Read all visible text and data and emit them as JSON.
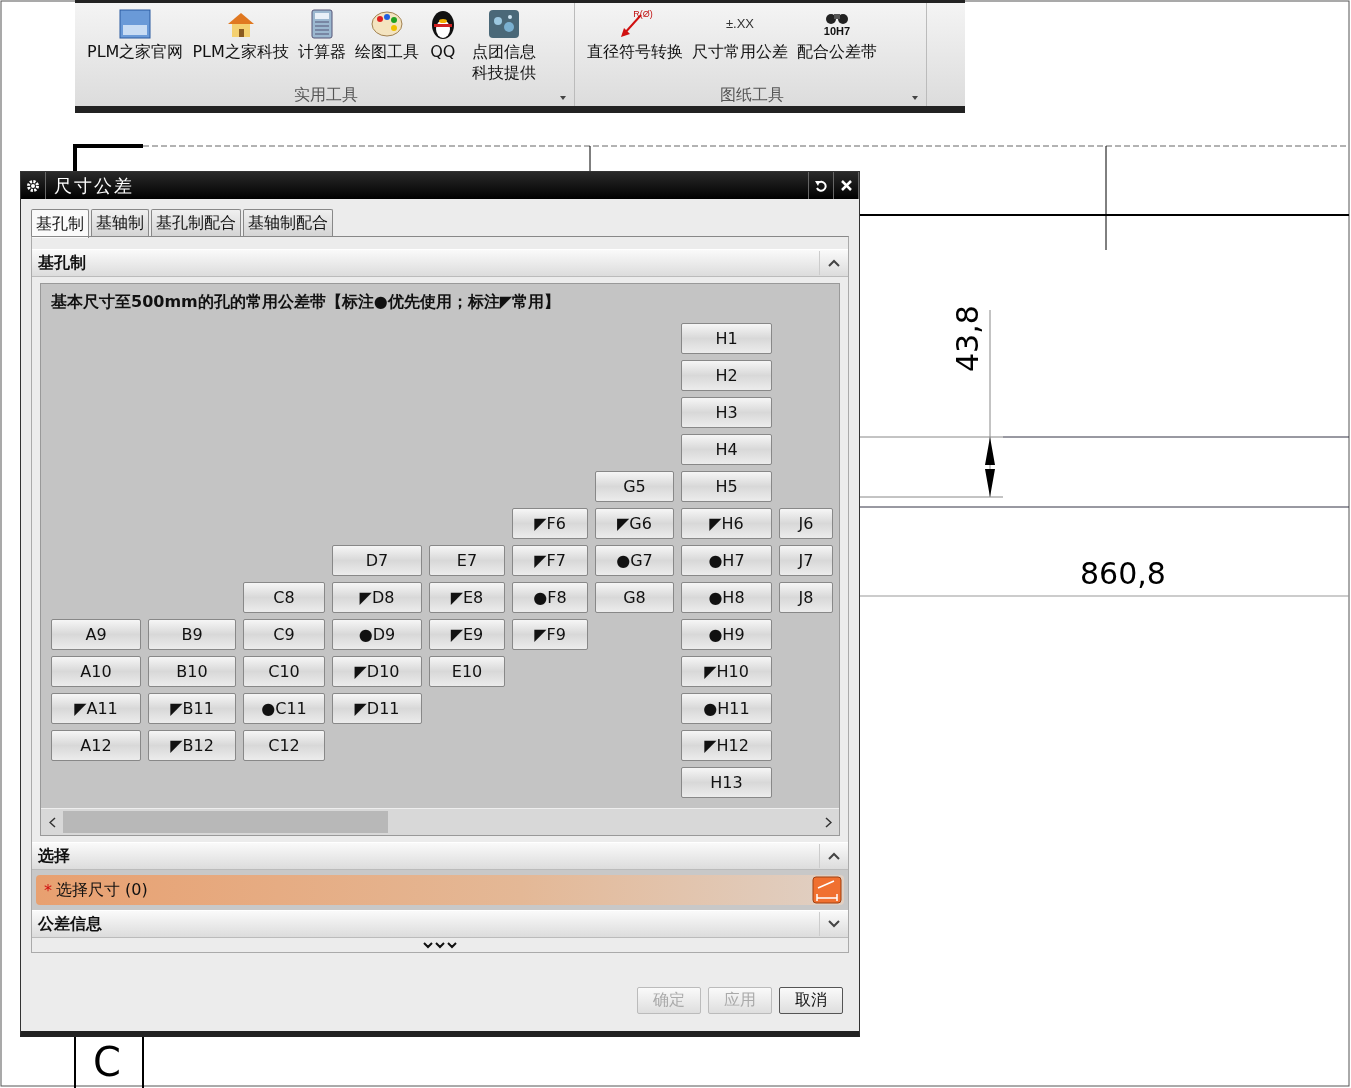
{
  "drawing": {
    "vertical_dimension": "43,8",
    "horizontal_dimension": "860,8",
    "title_block_letter": "C"
  },
  "ribbon": {
    "groups": [
      {
        "title": "实用工具",
        "tools": [
          {
            "label": "PLM之家官网"
          },
          {
            "label": "PLM之家科技"
          },
          {
            "label": "计算器"
          },
          {
            "label": "绘图工具"
          },
          {
            "label": "QQ"
          },
          {
            "label": "点团信息科技提供"
          }
        ]
      },
      {
        "title": "图纸工具",
        "tools": [
          {
            "label": "直径符号转换",
            "icon_text": "R(Ø)"
          },
          {
            "label": "尺寸常用公差",
            "icon_text": "±.XX"
          },
          {
            "label": "配合公差带",
            "icon_text": "10H7"
          }
        ]
      }
    ]
  },
  "dialog": {
    "title": "尺寸公差",
    "tabs": [
      {
        "label": "基孔制",
        "selected": true
      },
      {
        "label": "基轴制",
        "selected": false
      },
      {
        "label": "基孔制配合",
        "selected": false
      },
      {
        "label": "基轴制配合",
        "selected": false
      }
    ],
    "hole_section": {
      "title": "基孔制",
      "expanded": true,
      "caption": "基本尺寸至500mm的孔的常用公差带【标注●优先使用；标注◤常用】",
      "rows": [
        [
          null,
          null,
          null,
          null,
          null,
          null,
          null,
          "H1",
          null
        ],
        [
          null,
          null,
          null,
          null,
          null,
          null,
          null,
          "H2",
          null
        ],
        [
          null,
          null,
          null,
          null,
          null,
          null,
          null,
          "H3",
          null
        ],
        [
          null,
          null,
          null,
          null,
          null,
          null,
          null,
          "H4",
          null
        ],
        [
          null,
          null,
          null,
          null,
          null,
          null,
          "G5",
          "H5",
          null
        ],
        [
          null,
          null,
          null,
          null,
          null,
          "◤F6",
          "◤G6",
          "◤H6",
          "J6"
        ],
        [
          null,
          null,
          null,
          "D7",
          "E7",
          "◤F7",
          "●G7",
          "●H7",
          "J7"
        ],
        [
          null,
          null,
          "C8",
          "◤D8",
          "◤E8",
          "●F8",
          "G8",
          "●H8",
          "J8"
        ],
        [
          "A9",
          "B9",
          "C9",
          "●D9",
          "◤E9",
          "◤F9",
          null,
          "●H9",
          null
        ],
        [
          "A10",
          "B10",
          "C10",
          "◤D10",
          "E10",
          null,
          null,
          "◤H10",
          null
        ],
        [
          "◤A11",
          "◤B11",
          "●C11",
          "◤D11",
          null,
          null,
          null,
          "●H11",
          null
        ],
        [
          "A12",
          "◤B12",
          "C12",
          null,
          null,
          null,
          null,
          "◤H12",
          null
        ],
        [
          null,
          null,
          null,
          null,
          null,
          null,
          null,
          "H13",
          null
        ]
      ]
    },
    "select_section": {
      "title": "选择",
      "expanded": true,
      "field": {
        "label": "选择尺寸 (0)",
        "required_mark": "*"
      }
    },
    "info_section": {
      "title": "公差信息",
      "expanded": false
    },
    "buttons": [
      {
        "label": "确定",
        "disabled": true
      },
      {
        "label": "应用",
        "disabled": true
      },
      {
        "label": "取消",
        "disabled": false
      }
    ]
  }
}
